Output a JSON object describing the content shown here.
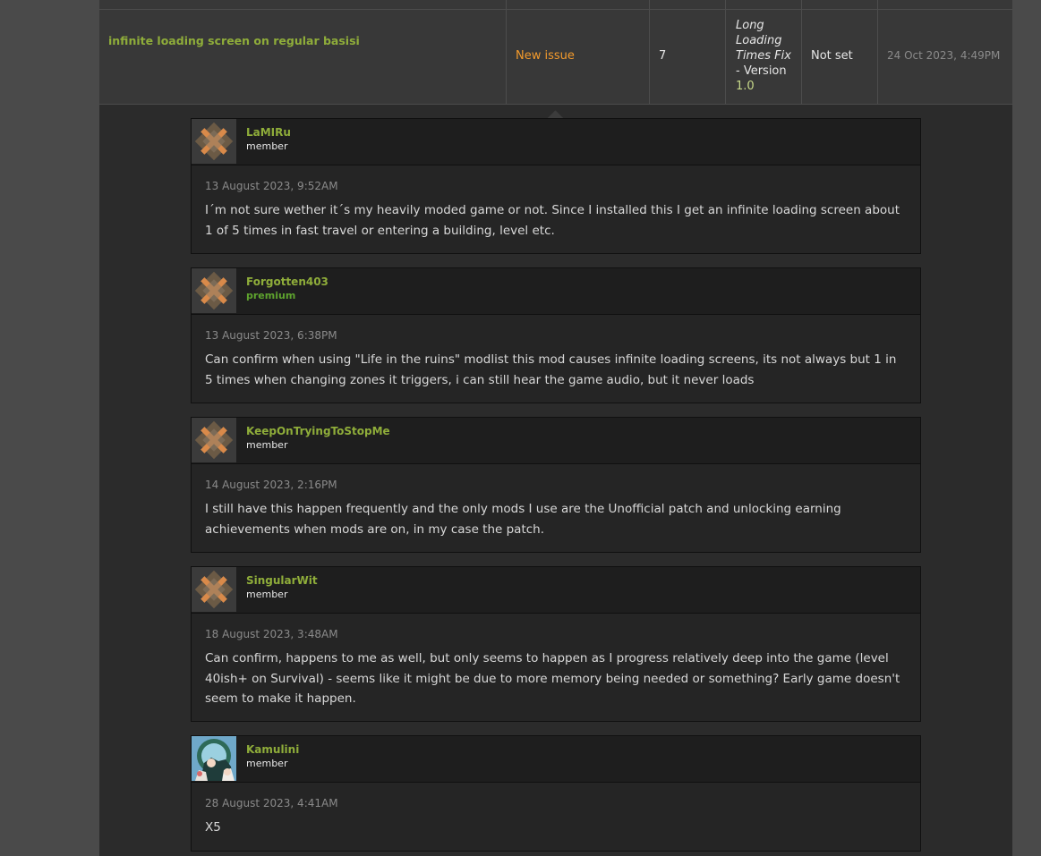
{
  "issue": {
    "title": "infinite loading screen on regular basisi",
    "status": "New issue",
    "replies": "7",
    "mod_version_name": "Long Loading Times Fix",
    "mod_version_prefix": "- Version",
    "mod_version_number": "1.0",
    "priority": "Not set",
    "last_updated": "24 Oct 2023, 4:49PM"
  },
  "comments": [
    {
      "username": "LaMIRu",
      "role": "member",
      "date": "13 August 2023, 9:52AM",
      "text": "I´m not sure wether it´s my heavily moded game or not. Since I installed this I get an infinite loading screen about 1 of 5 times in fast travel or entering a building, level etc."
    },
    {
      "username": "Forgotten403",
      "role": "premium",
      "date": "13 August 2023, 6:38PM",
      "text": "Can confirm when using \"Life in the ruins\" modlist this mod causes infinite loading screens, its not always but 1 in 5 times when changing zones it triggers, i can still hear the game audio, but it never loads"
    },
    {
      "username": "KeepOnTryingToStopMe",
      "role": "member",
      "date": "14 August 2023, 2:16PM",
      "text": "I still have this happen frequently and the only mods I use are the Unofficial patch and unlocking earning achievements when mods are on, in my case the patch."
    },
    {
      "username": "SingularWit",
      "role": "member",
      "date": "18 August 2023, 3:48AM",
      "text": "Can confirm, happens to me as well, but only seems to happen as I progress relatively deep into the game (level 40ish+ on Survival) - seems like it might be due to more memory being needed or something? Early game doesn't seem to make it happen."
    },
    {
      "username": "Kamulini",
      "role": "member",
      "date": "28 August 2023, 4:41AM",
      "text": "X5"
    }
  ],
  "icons": {
    "default_avatar": "default-avatar-icon",
    "custom_avatar": "user-avatar-image"
  },
  "colors": {
    "username": "#8fad3a",
    "status_new": "#f39a2c",
    "premium": "#5ea32e"
  }
}
